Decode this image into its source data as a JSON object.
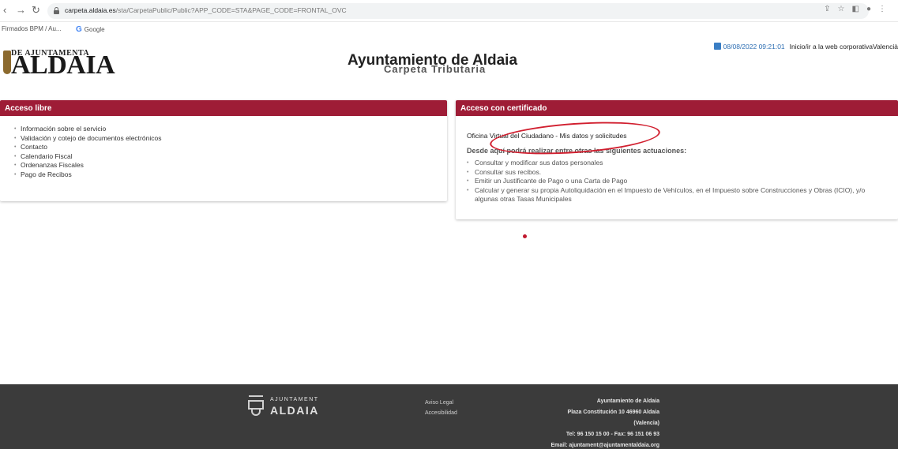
{
  "browser": {
    "url_host": "carpeta.aldaia.es",
    "url_path": "/sta/CarpetaPublic/Public?APP_CODE=STA&PAGE_CODE=FRONTAL_OVC",
    "bookmarks": [
      "Firmados BPM / Au...",
      "Google"
    ]
  },
  "header": {
    "logo_top": "DE AJUNTAMENTA",
    "logo_main": "ALDAIA",
    "title": "Ayuntamiento de Aldaia",
    "subtitle": "Carpeta Tributaria",
    "datetime": "08/08/2022 09:21:01",
    "top_link": "Inicio/ir a la web corporativaValencià"
  },
  "left_panel": {
    "title": "Acceso libre",
    "items": [
      "Información sobre el servicio",
      "Validación y cotejo de documentos electrónicos",
      "Contacto",
      "Calendario Fiscal",
      "Ordenanzas Fiscales",
      "Pago de Recibos"
    ]
  },
  "right_panel": {
    "title": "Acceso con certificado",
    "ovc_link": "Oficina Virtual del Ciudadano - Mis datos y solicitudes",
    "description": "Desde aquí podrá realizar entre otras las siguientes actuaciones:",
    "items": [
      "Consultar y modificar sus datos personales",
      "Consultar sus recibos.",
      "Emitir un Justificante de Pago o una Carta de Pago",
      "Calcular y generar su propia Autoliquidación en el Impuesto de Vehículos, en el Impuesto sobre Construcciones y Obras (ICIO), y/o algunas otras Tasas Municipales"
    ]
  },
  "footer": {
    "logo_line1": "AJUNTAMENT",
    "logo_line2": "ALDAIA",
    "links": [
      "Aviso Legal",
      "Accesibilidad"
    ],
    "info": [
      "Ayuntamiento de Aldaia",
      "Plaza Constitución 10 46960 Aldaia",
      "(Valencia)",
      "Tel: 96 150 15 00 - Fax: 96 151 06 93",
      "Email: ajuntament@ajuntamentaldaia.org"
    ]
  },
  "colors": {
    "panel_header": "#9e1c36",
    "footer_bg": "#3b3b3b",
    "annotation": "#d11f2f"
  }
}
